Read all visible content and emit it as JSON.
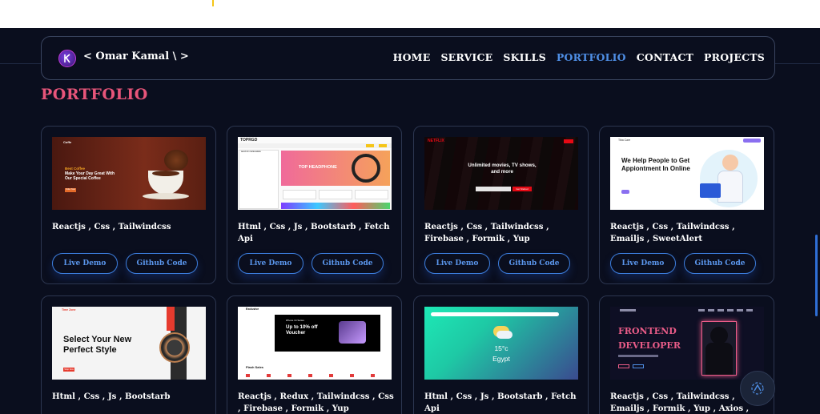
{
  "nav": {
    "logo_text": "< Omar Kamal \\ >",
    "links": [
      "HOME",
      "SERVICE",
      "SKILLS",
      "PORTFOLIO",
      "CONTACT",
      "PROJECTS"
    ],
    "active": "PORTFOLIO"
  },
  "section": {
    "title": "PORTFOLIO"
  },
  "buttons": {
    "demo": "Live Demo",
    "code": "Github Code"
  },
  "projects": [
    {
      "tech": "Reactjs , Css , Tailwindcss",
      "thumb": {
        "brand": "Coffe",
        "eyebrow": "Best Coffee",
        "headline": "Make Your Day Great With Our Special Coffee",
        "cta": "Order Now"
      }
    },
    {
      "tech": "Html , Css , Js , Bootstarb , Fetch Api",
      "thumb": {
        "brand": "TOPRGD",
        "headline": "TOP HEADPHONE",
        "sidebar_title": "SHOP BY CATEGORIES"
      }
    },
    {
      "tech": "Reactjs , Css , Tailwindcss , Firebase , Formik , Yup",
      "thumb": {
        "brand": "NETFLIX",
        "headline": "Unlimited movies, TV shows, and more",
        "cta": "Get Started"
      }
    },
    {
      "tech": "Reactjs , Css , Tailwindcss , Emailjs , SweetAlert",
      "thumb": {
        "brand": "Tiba Care",
        "headline": "We Help People to Get Appiontment In Online"
      }
    },
    {
      "tech": "Html , Css , Js , Bootstarb",
      "thumb": {
        "brand": "Time Zone",
        "headline": "Select Your New Perfect Style",
        "cta": "Shop Now"
      }
    },
    {
      "tech": "Reactjs , Redux , Tailwindcss , Css , Firebase , Formik , Yup",
      "thumb": {
        "brand": "Exclusive",
        "headline": "Up to 10% off Voucher",
        "sub": "iPhone 14 Series",
        "section": "Flash Sales"
      }
    },
    {
      "tech": "Html , Css , Js , Bootstarb , Fetch Api",
      "thumb": {
        "temp": "15°c",
        "city": "Egypt"
      }
    },
    {
      "tech": "Reactjs , Css , Tailwindcss , Emailjs , Formik , Yup , Axios , AOS",
      "thumb": {
        "line1": "FRONTEND",
        "line2": "DEVELOPER"
      }
    }
  ],
  "colors": {
    "background": "#0a0e1e",
    "accent_pink": "#e8557a",
    "accent_blue": "#4f8fe6"
  },
  "icons": {
    "logo": "k-logo-icon",
    "floating_button": "accessibility-icon"
  }
}
